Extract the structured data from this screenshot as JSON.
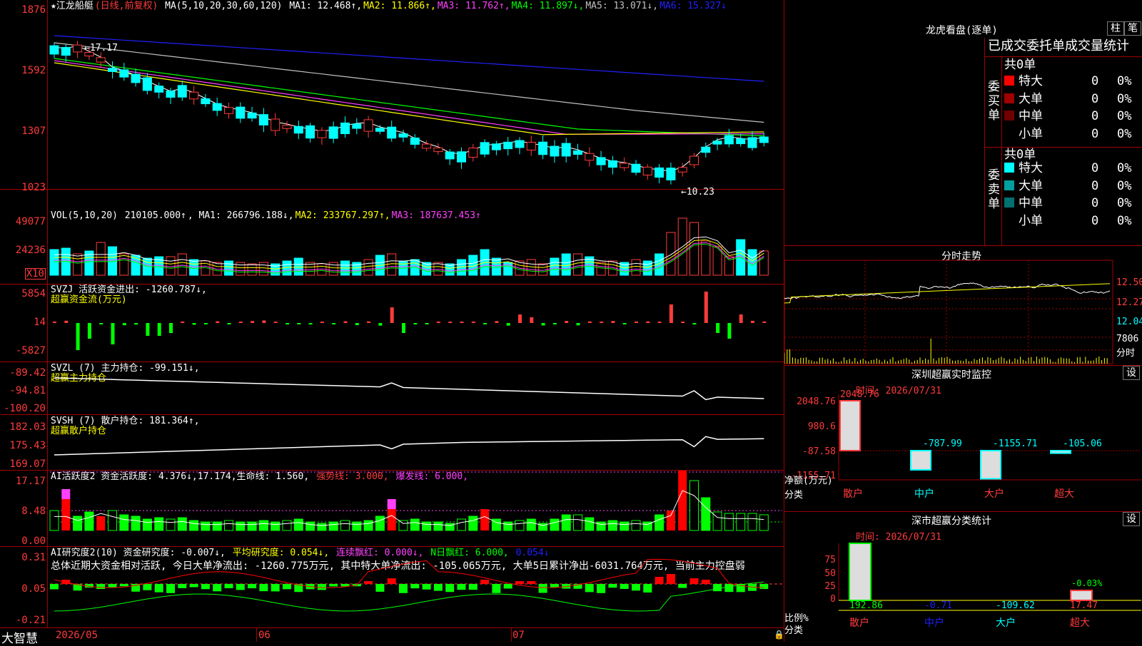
{
  "stock": {
    "name": "★江龙船艇",
    "mode": "(日线,前复权)",
    "ma_label": "MA(5,10,20,30,60,120)",
    "ma": [
      {
        "label": "MA1:",
        "value": "12.468↑",
        "color": "#ffffff"
      },
      {
        "label": "MA2:",
        "value": "11.866↑",
        "color": "#ffff00"
      },
      {
        "label": "MA3:",
        "value": "11.762↑",
        "color": "#ff40ff"
      },
      {
        "label": "MA4:",
        "value": "11.897↓",
        "color": "#00ff00"
      },
      {
        "label": "MA5:",
        "value": "13.071↓",
        "color": "#c0c0c0"
      },
      {
        "label": "MA6:",
        "value": "15.327↓",
        "color": "#2020ff"
      }
    ],
    "price_axis": [
      "1876",
      "1592",
      "1307",
      "1023"
    ],
    "high_mark": "17.17",
    "low_mark": "10.23"
  },
  "volume": {
    "label": "VOL(5,10,20)",
    "value": "210105.000↑",
    "ma": [
      {
        "label": "MA1:",
        "value": "266796.188↓",
        "color": "#ffffff"
      },
      {
        "label": "MA2:",
        "value": "233767.297↑",
        "color": "#ffff00"
      },
      {
        "label": "MA3:",
        "value": "187637.453↑",
        "color": "#ff40ff"
      }
    ],
    "axis": [
      "49077",
      "24236"
    ],
    "unit": "X10"
  },
  "svzj": {
    "label": "SVZJ  活跃资金进出: -1260.787↓,",
    "sub": "超赢资金流(万元)",
    "axis": [
      "5854",
      "14",
      "-5827"
    ]
  },
  "svzl": {
    "label": "SVZL (7) 主力持仓: -99.151↓,",
    "sub": "超赢主力持仓",
    "axis": [
      "-89.42",
      "-94.81",
      "-100.20"
    ]
  },
  "svsh": {
    "label": "SVSH (7) 散户持仓: 181.364↑,",
    "sub": "超赢散户持仓",
    "axis": [
      "182.03",
      "175.43",
      "169.07"
    ]
  },
  "ai_active": {
    "label": "AI活跃度2 资金活跃度: 4.376↓,17.174,生命线: 1.560,",
    "strong": "强势线: 3.000,",
    "burst": "爆发线: 6.000,",
    "axis": [
      "17.17",
      "8.48",
      "0.00"
    ]
  },
  "ai_research": {
    "label": "AI研究度2(10) 资金研究度: -0.007↓,",
    "avg": "平均研究度: 0.054↓,",
    "cont": "连续飘红: 0.000↓,",
    "nday": "N日飘红: 6.000,",
    "last": "0.054↓",
    "summary": "总体近期大资金相对活跃, 今日大单净流出: -1260.775万元, 其中特大单净流出: -105.065万元, 大单5日累计净出-6031.764万元, 当前主力控盘弱",
    "axis": [
      "0.31",
      "0.05",
      "-0.21"
    ]
  },
  "footer": {
    "brand": "大智慧",
    "dates": [
      "2026/05",
      "06",
      "07"
    ]
  },
  "dragon": {
    "title": "龙虎看盘(逐单)",
    "btn_zhu": "柱",
    "btn_bi": "笔",
    "heading": "已成交委托单成交量统计",
    "buy_side": "委买单",
    "sell_side": "委卖单",
    "buy_total": "共0单",
    "sell_total": "共0单",
    "buy_rows": [
      {
        "label": "特大",
        "count": "0",
        "pct": "0%",
        "color": "#ff0000"
      },
      {
        "label": "大单",
        "count": "0",
        "pct": "0%",
        "color": "#a00000"
      },
      {
        "label": "中单",
        "count": "0",
        "pct": "0%",
        "color": "#700000"
      },
      {
        "label": "小单",
        "count": "0",
        "pct": "0%",
        "color": "#000000"
      }
    ],
    "sell_rows": [
      {
        "label": "特大",
        "count": "0",
        "pct": "0%",
        "color": "#00ffff"
      },
      {
        "label": "大单",
        "count": "0",
        "pct": "0%",
        "color": "#00a0a0"
      },
      {
        "label": "中单",
        "count": "0",
        "pct": "0%",
        "color": "#007070"
      },
      {
        "label": "小单",
        "count": "0",
        "pct": "0%",
        "color": "#000000"
      }
    ]
  },
  "intraday": {
    "title": "分时走势",
    "prices": [
      "12.50",
      "12.27",
      "12.04"
    ],
    "vol": "7806",
    "label": "分时"
  },
  "sz_monitor": {
    "title": "深圳超赢实时监控",
    "btn": "设",
    "time": "时间: 2026/07/31",
    "axis": [
      "2048.76",
      "980.6",
      "-87.58",
      "-1155.71"
    ],
    "net_label": "净额(万元)",
    "cat_label": "分类",
    "bars": [
      {
        "cat": "散户",
        "value": "2048.76"
      },
      {
        "cat": "中户",
        "value": "-787.99"
      },
      {
        "cat": "大户",
        "value": "-1155.71"
      },
      {
        "cat": "超大",
        "value": "-105.06"
      }
    ]
  },
  "sz_class": {
    "title": "深市超赢分类统计",
    "btn": "设",
    "time": "时间: 2026/07/31",
    "axis": [
      "75",
      "50",
      "25",
      "0"
    ],
    "ratio_label": "比例%",
    "cat_label": "分类",
    "bars": [
      {
        "cat": "散户",
        "value": "192.86",
        "color": "#00ff00"
      },
      {
        "cat": "中户",
        "value": "-0.71",
        "color": "#2020ff"
      },
      {
        "cat": "大户",
        "value": "-109.62",
        "color": "#00ffff"
      },
      {
        "cat": "超大",
        "value": "17.47",
        "color": "#ff3b3b"
      }
    ],
    "chaoda_pct": "-0.03%"
  }
}
